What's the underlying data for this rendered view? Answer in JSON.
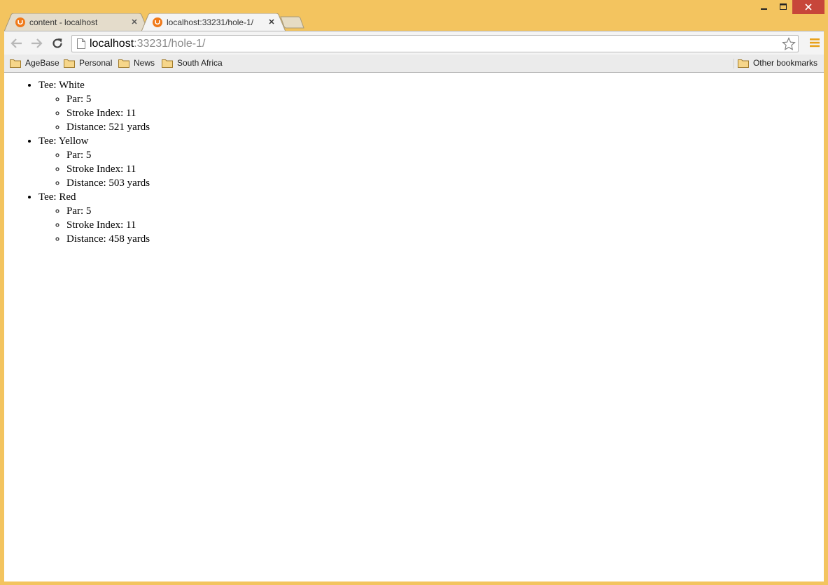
{
  "window": {
    "controls": [
      "minimize",
      "maximize",
      "close"
    ]
  },
  "tabs": [
    {
      "title": "content - localhost",
      "active": false,
      "icon": "umbraco-favicon"
    },
    {
      "title": "localhost:33231/hole-1/",
      "active": true,
      "icon": "umbraco-favicon"
    }
  ],
  "omnibox": {
    "host": "localhost",
    "path": ":33231/hole-1/"
  },
  "bookmarks": {
    "items": [
      "AgeBase",
      "Personal",
      "News",
      "South Africa"
    ],
    "other": "Other bookmarks"
  },
  "content": {
    "tees": [
      {
        "label": "Tee: White",
        "par": "Par: 5",
        "stroke_index": "Stroke Index: 11",
        "distance": "Distance: 521 yards"
      },
      {
        "label": "Tee: Yellow",
        "par": "Par: 5",
        "stroke_index": "Stroke Index: 11",
        "distance": "Distance: 503 yards"
      },
      {
        "label": "Tee: Red",
        "par": "Par: 5",
        "stroke_index": "Stroke Index: 11",
        "distance": "Distance: 458 yards"
      }
    ]
  },
  "colors": {
    "frame": "#f3c45f",
    "favicon": "#f07a1a",
    "menu": "#e8a11b",
    "close": "#c7463a"
  }
}
